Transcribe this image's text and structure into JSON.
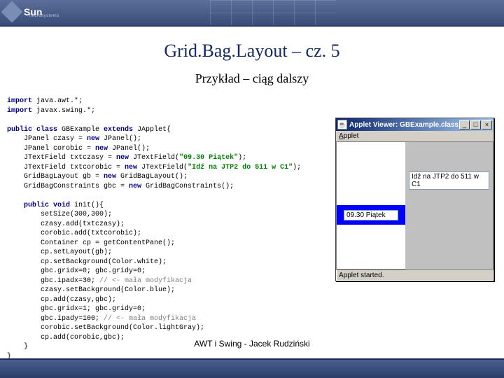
{
  "logo": {
    "brand": "Sun",
    "sub": "microsystems"
  },
  "title": "Grid.Bag.Layout – cz. 5",
  "subtitle": "Przykład – ciąg dalszy",
  "code": {
    "l1a": "import",
    "l1b": " java.awt.*;",
    "l2a": "import",
    "l2b": " javax.swing.*;",
    "l3a": "public class ",
    "l3b": "GBExample ",
    "l3c": "extends ",
    "l3d": "JApplet{",
    "l4a": "    JPanel czasy = ",
    "l4b": "new ",
    "l4c": "JPanel();",
    "l5a": "    JPanel corobic = ",
    "l5b": "new ",
    "l5c": "JPanel();",
    "l6a": "    JTextField txtczasy = ",
    "l6b": "new ",
    "l6c": "JTextField(",
    "l6d": "\"09.30 Piątek\"",
    "l6e": ");",
    "l7a": "    JTextField txtcorobic = ",
    "l7b": "new ",
    "l7c": "JTextField(",
    "l7d": "\"Idź na JTP2 do 511 w C1\"",
    "l7e": ");",
    "l8a": "    GridBagLayout gb = ",
    "l8b": "new ",
    "l8c": "GridBagLayout();",
    "l9a": "    GridBagConstraints gbc = ",
    "l9b": "new ",
    "l9c": "GridBagConstraints();",
    "l10a": "    public void ",
    "l10b": "init(){",
    "l11": "        setSize(300,300);",
    "l12": "        czasy.add(txtczasy);",
    "l13": "        corobic.add(txtcorobic);",
    "l14": "        Container cp = getContentPane();",
    "l15": "        cp.setLayout(gb);",
    "l16": "        cp.setBackground(Color.white);",
    "l17": "        gbc.gridx=0; gbc.gridy=0;",
    "l18a": "        gbc.ipadx=30; ",
    "l18b": "// <- mała modyfikacja",
    "l19": "        czasy.setBackground(Color.blue);",
    "l20": "        cp.add(czasy,gbc);",
    "l21": "        gbc.gridx=1; gbc.gridy=0;",
    "l22a": "        gbc.ipady=100; ",
    "l22b": "// <- mała modyfikacja",
    "l23": "        corobic.setBackground(Color.lightGray);",
    "l24": "        cp.add(corobic,gbc);",
    "l25": "    }",
    "l26": "}"
  },
  "applet": {
    "title": "Applet Viewer: GBExample.class",
    "menu": "Applet",
    "field1": "09.30 Piątek",
    "field2": "Idź na JTP2 do 511 w C1",
    "status": "Applet started."
  },
  "winbtns": {
    "min": "_",
    "max": "□",
    "close": "×"
  },
  "footer": "AWT i Swing - Jacek Rudziński"
}
